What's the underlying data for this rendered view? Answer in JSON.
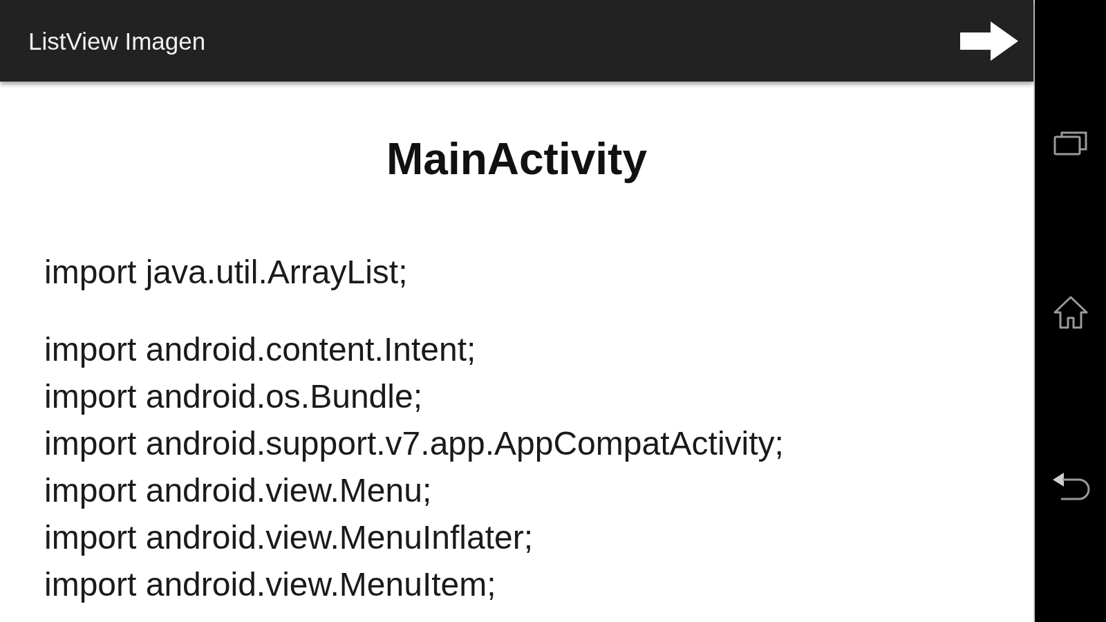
{
  "app_bar": {
    "title": "ListView Imagen"
  },
  "heading": "MainActivity",
  "code_blocks": [
    [
      "import java.util.ArrayList;"
    ],
    [
      "import android.content.Intent;",
      "import android.os.Bundle;",
      "import android.support.v7.app.AppCompatActivity;",
      "import android.view.Menu;",
      "import android.view.MenuInflater;",
      "import android.view.MenuItem;"
    ]
  ]
}
